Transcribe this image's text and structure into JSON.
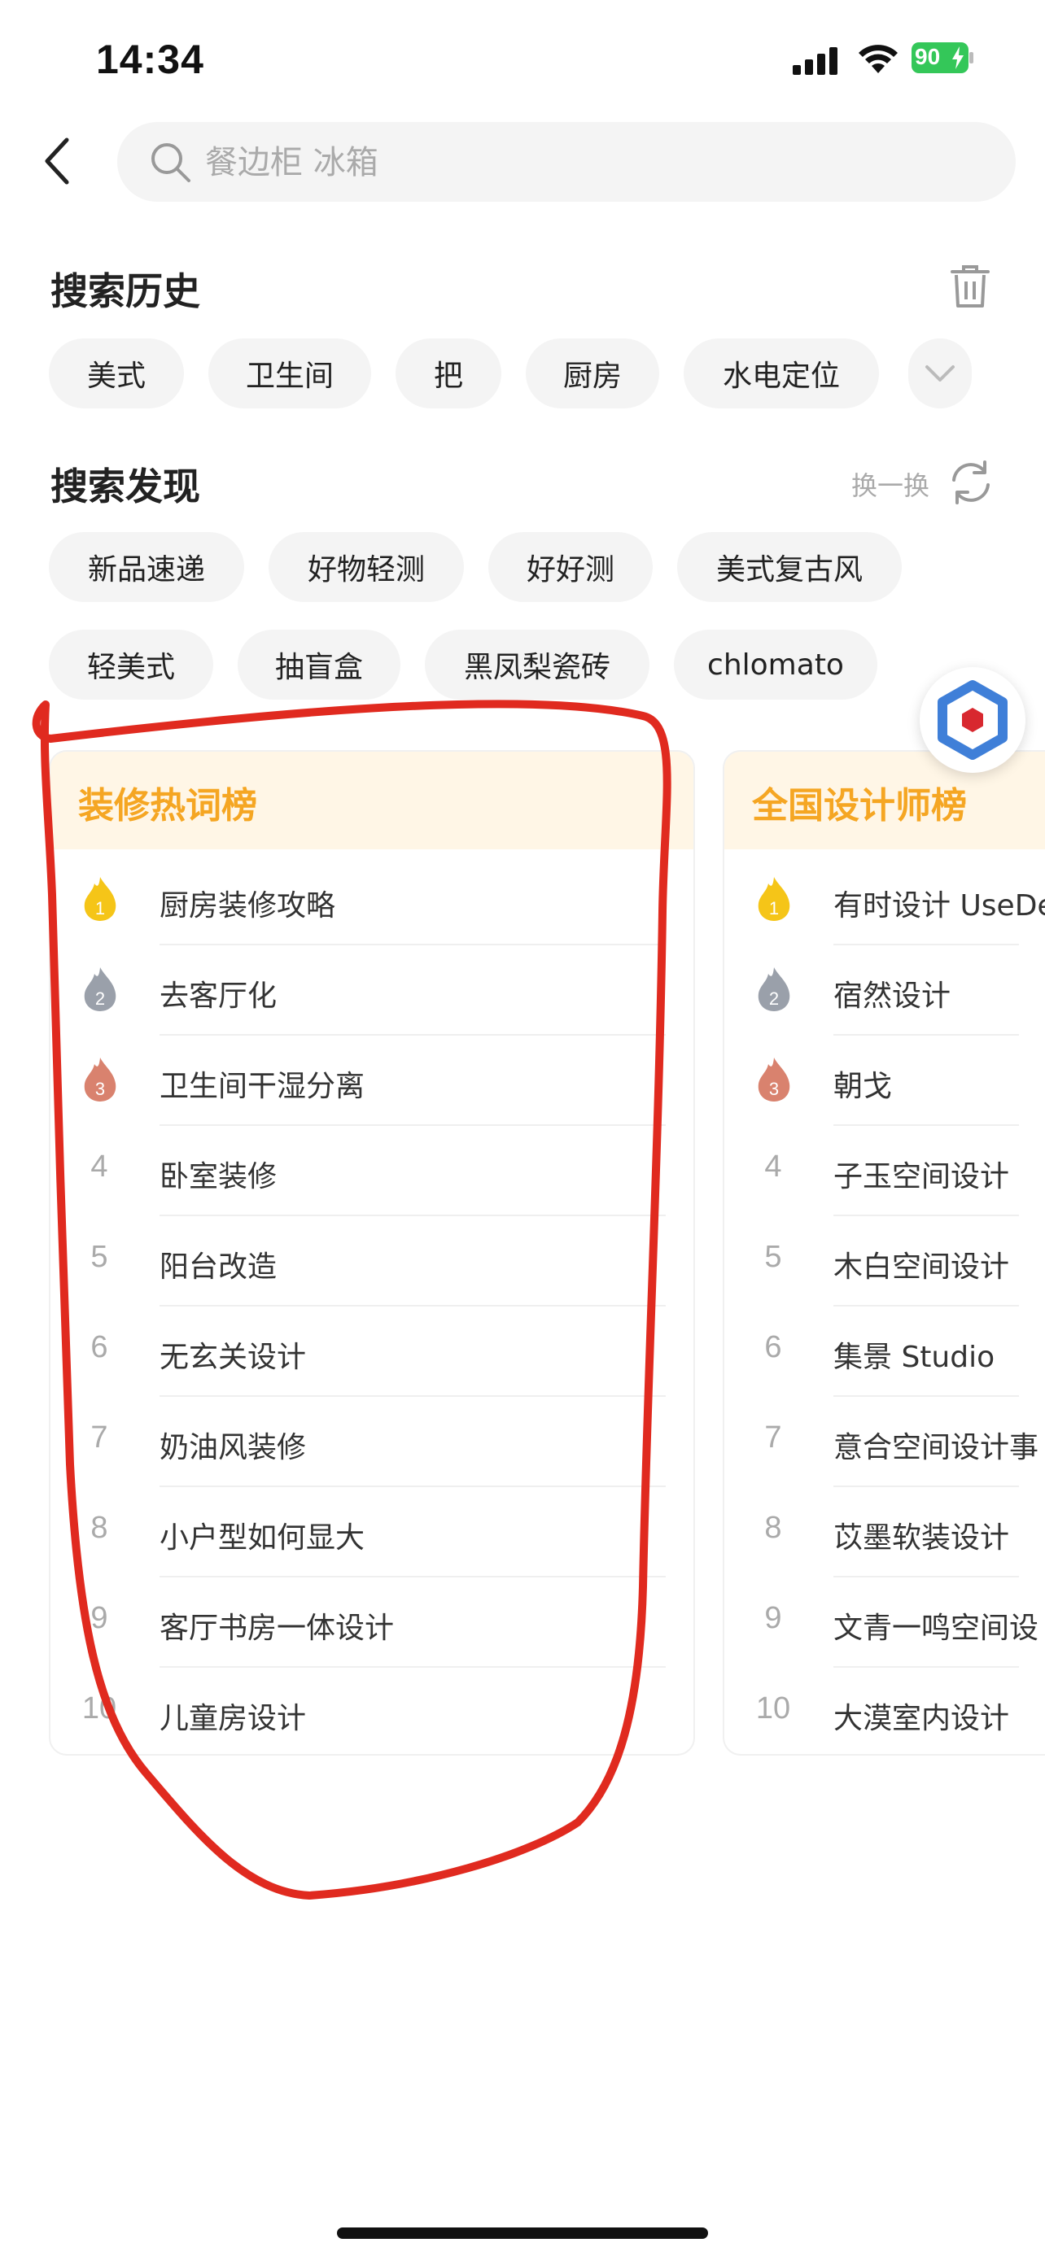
{
  "status_bar": {
    "time": "14:34",
    "battery": "90"
  },
  "search": {
    "placeholder": "餐边柜 冰箱"
  },
  "history": {
    "title": "搜索历史",
    "chips": [
      "美式",
      "卫生间",
      "把",
      "厨房",
      "水电定位"
    ]
  },
  "discover": {
    "title": "搜索发现",
    "refresh_label": "换一换",
    "chips": [
      "新品速递",
      "好物轻测",
      "好好测",
      "美式复古风",
      "轻美式",
      "抽盲盒",
      "黑凤梨瓷砖",
      "chlomato"
    ]
  },
  "rank_cards": [
    {
      "title": "装修热词榜",
      "items": [
        {
          "rank": "1",
          "label": "厨房装修攻略"
        },
        {
          "rank": "2",
          "label": "去客厅化"
        },
        {
          "rank": "3",
          "label": "卫生间干湿分离"
        },
        {
          "rank": "4",
          "label": "卧室装修"
        },
        {
          "rank": "5",
          "label": "阳台改造"
        },
        {
          "rank": "6",
          "label": "无玄关设计"
        },
        {
          "rank": "7",
          "label": "奶油风装修"
        },
        {
          "rank": "8",
          "label": "小户型如何显大"
        },
        {
          "rank": "9",
          "label": "客厅书房一体设计"
        },
        {
          "rank": "10",
          "label": "儿童房设计"
        }
      ]
    },
    {
      "title": "全国设计师榜",
      "items": [
        {
          "rank": "1",
          "label": "有时设计 UseDe"
        },
        {
          "rank": "2",
          "label": "宿然设计"
        },
        {
          "rank": "3",
          "label": "朝戈"
        },
        {
          "rank": "4",
          "label": "子玉空间设计"
        },
        {
          "rank": "5",
          "label": "木白空间设计"
        },
        {
          "rank": "6",
          "label": "集景 Studio"
        },
        {
          "rank": "7",
          "label": "意合空间设计事"
        },
        {
          "rank": "8",
          "label": "苡墨软装设计"
        },
        {
          "rank": "9",
          "label": "文青一鸣空间设"
        },
        {
          "rank": "10",
          "label": "大漠室内设计"
        }
      ]
    }
  ],
  "colors": {
    "accent": "#f5a623",
    "card_header_bg": "#fff6e6",
    "gold": "#f5c518",
    "silver": "#9aa0aa",
    "bronze": "#d9826e",
    "annotation": "#e02a1f"
  },
  "icons": {
    "back": "chevron-left-icon",
    "search": "search-icon",
    "trash": "trash-icon",
    "refresh": "refresh-icon",
    "expand": "chevron-down-icon",
    "float": "hexagon-badge-icon"
  }
}
